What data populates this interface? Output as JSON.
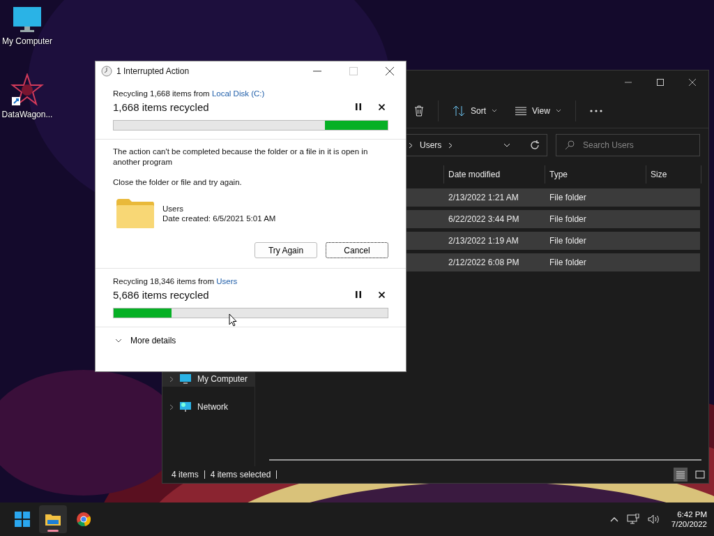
{
  "desktop_icons": [
    {
      "label": "My Computer",
      "kind": "monitor"
    },
    {
      "label": "DataWagon...",
      "kind": "shortcut"
    }
  ],
  "explorer": {
    "toolbar": [
      {
        "kind": "delete"
      },
      {
        "kind": "sort",
        "label": "Sort"
      },
      {
        "kind": "view",
        "label": "View"
      },
      {
        "kind": "more"
      }
    ],
    "address": {
      "crumb": "Users"
    },
    "search": {
      "placeholder": "Search Users"
    },
    "columns": [
      "Date modified",
      "Type",
      "Size"
    ],
    "rows": [
      {
        "date": "2/13/2022 1:21 AM",
        "type": "File folder",
        "selected": true
      },
      {
        "date": "6/22/2022 3:44 PM",
        "type": "File folder",
        "selected": true
      },
      {
        "date": "2/13/2022 1:19 AM",
        "type": "File folder",
        "selected": true
      },
      {
        "date": "2/12/2022 6:08 PM",
        "type": "File folder",
        "selected": true
      }
    ],
    "sidebar": [
      {
        "label": "My Computer",
        "kind": "computer"
      },
      {
        "label": "Network",
        "kind": "network"
      }
    ],
    "status_bar": {
      "count": "4 items",
      "selection": "4 items selected"
    }
  },
  "dialog": {
    "title": "1 Interrupted Action",
    "operations": [
      {
        "prefix": "Recycling 1,668 items from ",
        "source": "Local Disk (C:)",
        "progress": "1,668 items recycled",
        "kind": "indeterminate",
        "level": 0.23
      },
      {
        "prefix": "Recycling 18,346 items from ",
        "source": "Users",
        "progress": "5,686 items recycled",
        "kind": "determinate",
        "level": 0.21
      }
    ],
    "error": {
      "message": "The action can't be completed because the folder or a file in it is open in another program",
      "hint": "Close the folder or file and try again.",
      "item_name": "Users",
      "item_date": "Date created: 6/5/2021 5:01 AM",
      "buttons": [
        "Try Again",
        "Cancel"
      ]
    },
    "details": "More details"
  },
  "taskbar": {
    "apps": [
      {
        "kind": "start",
        "selected": false
      },
      {
        "kind": "explorer",
        "selected": true
      },
      {
        "kind": "browser",
        "selected": false
      }
    ],
    "time": "6:42 PM",
    "date": "7/20/2022"
  }
}
